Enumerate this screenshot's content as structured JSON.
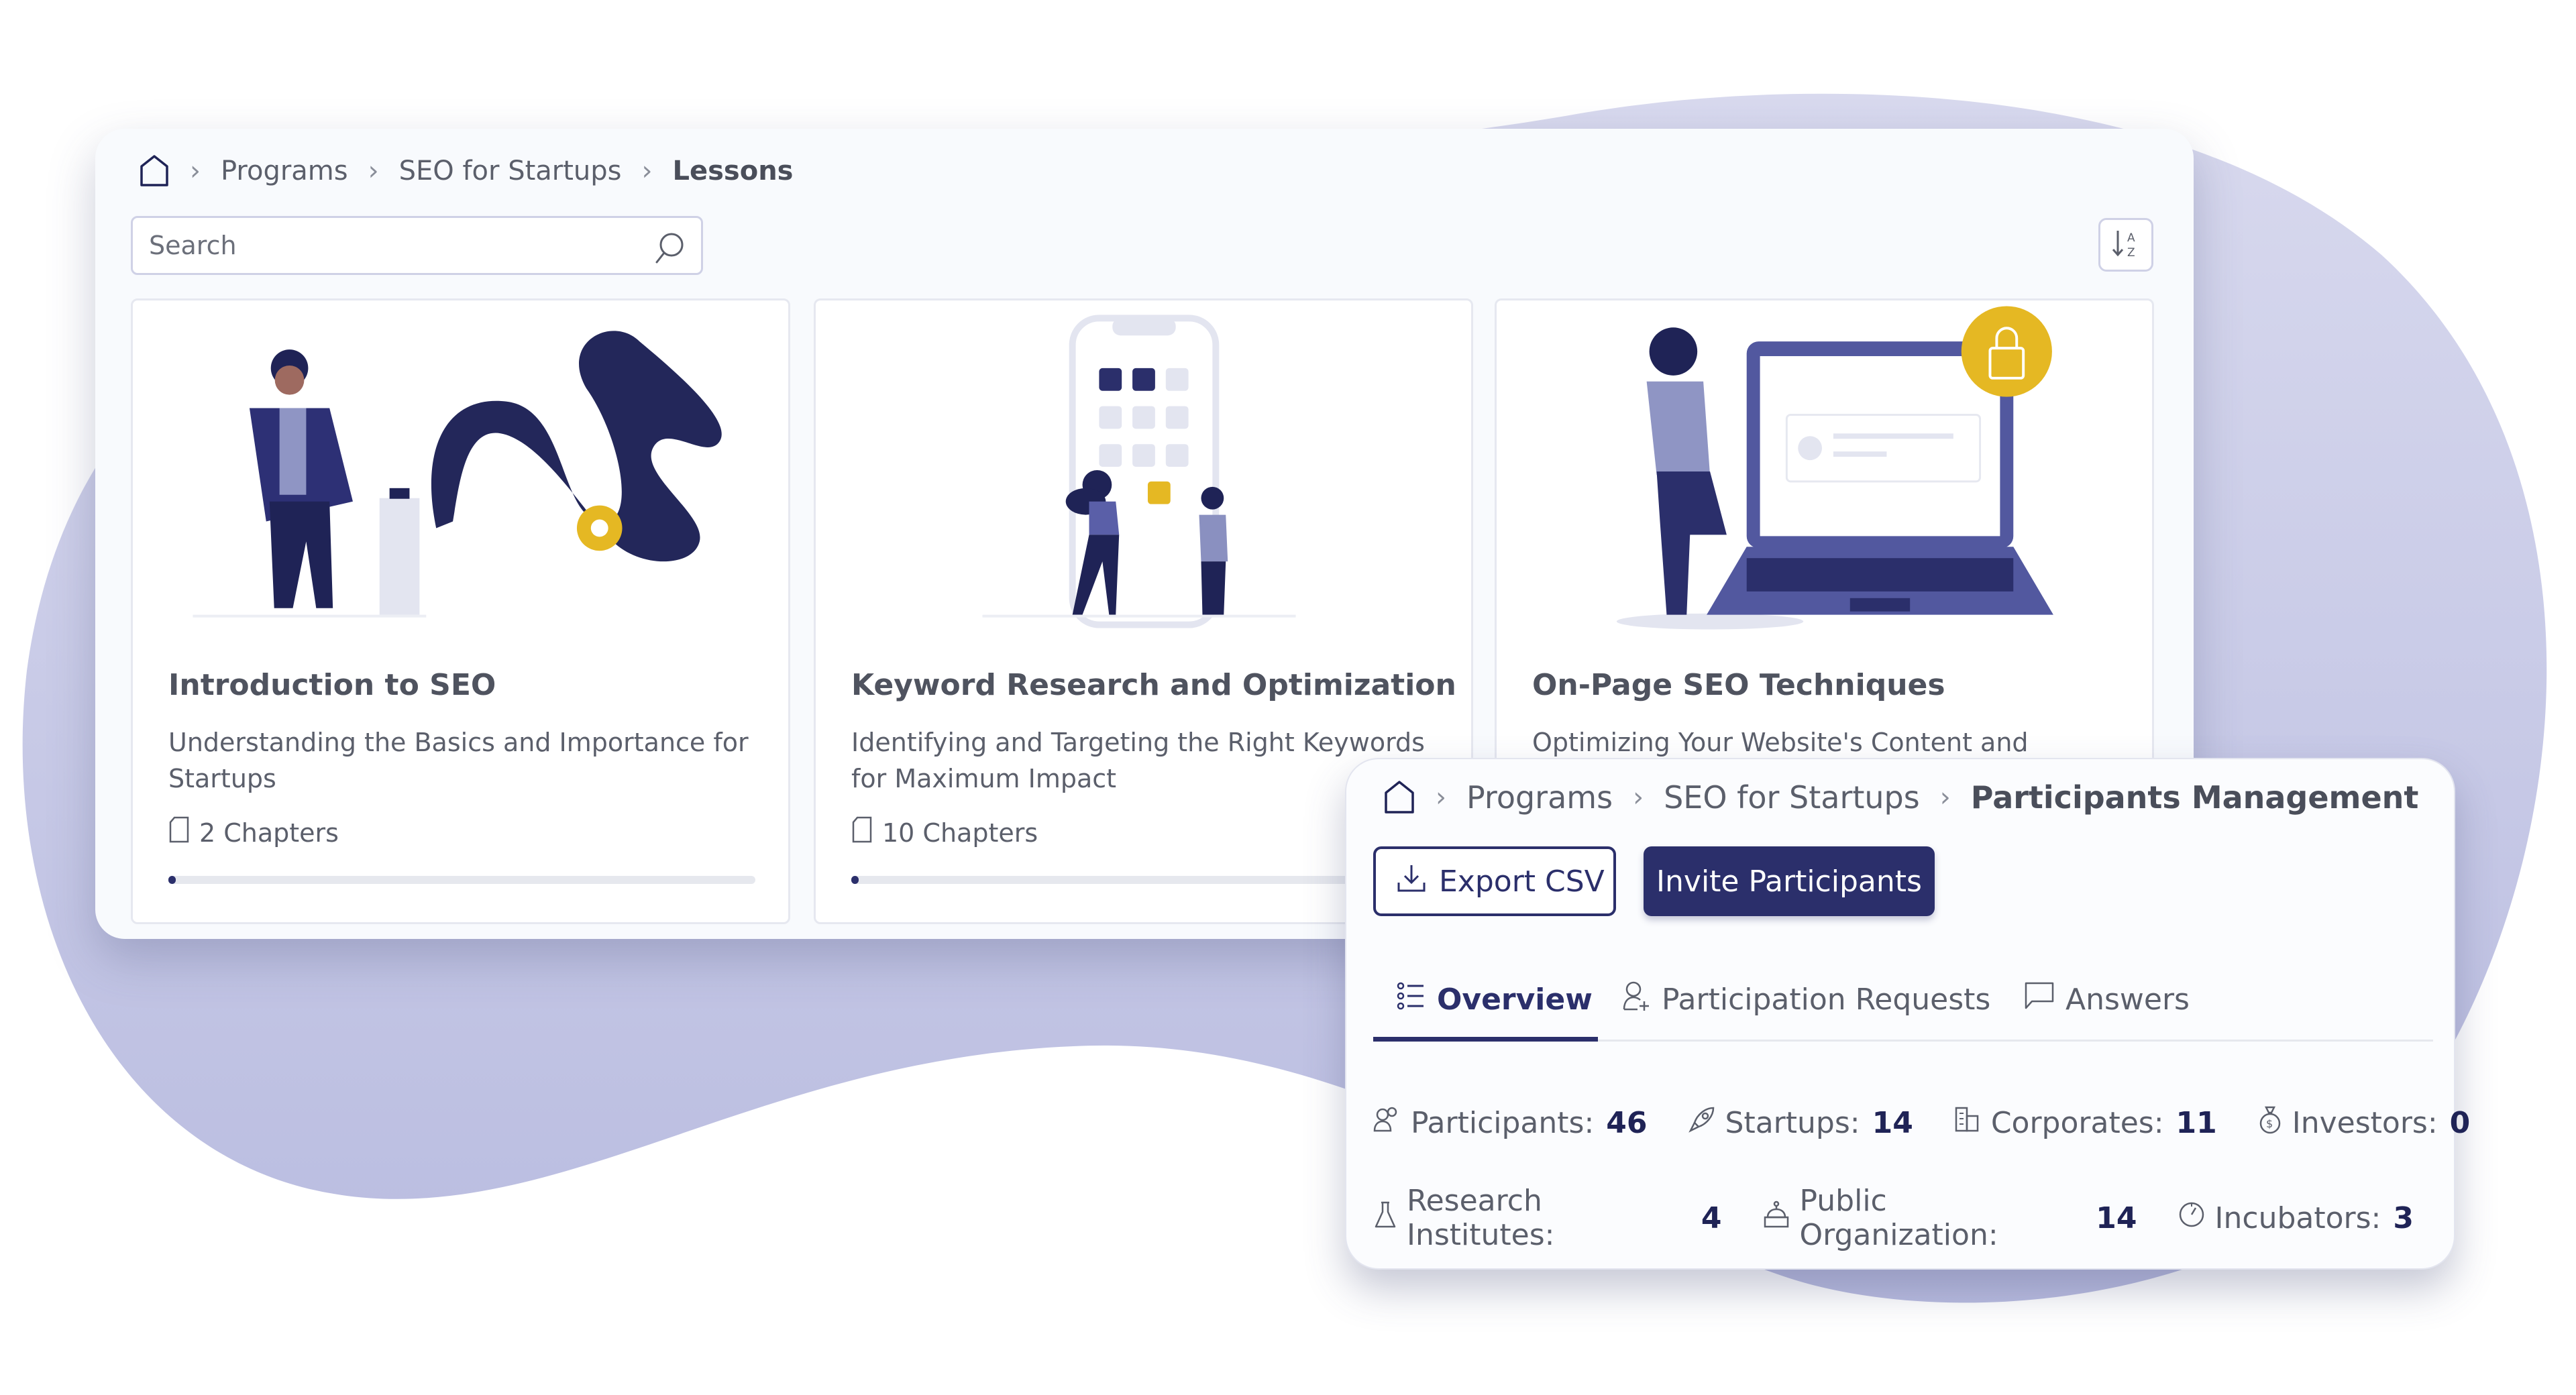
{
  "colors": {
    "primary": "#2b2f6b",
    "accent_yellow": "#e5b823",
    "blob": "#c9cbe6",
    "text": "#5b5f6b"
  },
  "lessons_view": {
    "breadcrumb": [
      {
        "label": "Programs"
      },
      {
        "label": "SEO for Startups"
      },
      {
        "label": "Lessons",
        "current": true
      }
    ],
    "search": {
      "placeholder": "Search",
      "value": ""
    },
    "sort_button": {
      "icon": "sort-alpha-down-icon"
    },
    "cards": [
      {
        "title": "Introduction to SEO",
        "description": "Understanding the Basics and Importance for Startups",
        "chapters": "2 Chapters",
        "progress": 0.01,
        "illustration": "person-pressing-launch-button"
      },
      {
        "title": "Keyword Research and Optimization",
        "description": "Identifying and Targeting the Right Keywords for Maximum Impact",
        "chapters": "10 Chapters",
        "progress": 0.01,
        "illustration": "people-arranging-app-tiles"
      },
      {
        "title": "On-Page SEO Techniques",
        "description": "Optimizing Your Website's Content and Structure",
        "chapters": "",
        "progress": 0,
        "illustration": "woman-with-locked-laptop",
        "locked": true
      }
    ]
  },
  "participants_view": {
    "breadcrumb": [
      {
        "label": "Programs"
      },
      {
        "label": "SEO for Startups"
      },
      {
        "label": "Participants Management",
        "current": true
      }
    ],
    "export_button": "Export CSV",
    "invite_button": "Invite Participants",
    "tabs": [
      {
        "label": "Overview",
        "active": true,
        "icon": "list-icon"
      },
      {
        "label": "Participation Requests",
        "active": false,
        "icon": "user-add-icon"
      },
      {
        "label": "Answers",
        "active": false,
        "icon": "comment-icon"
      }
    ],
    "stats_row1": [
      {
        "label": "Participants:",
        "value": "46",
        "icon": "users-icon"
      },
      {
        "label": "Startups:",
        "value": "14",
        "icon": "rocket-icon"
      },
      {
        "label": "Corporates:",
        "value": "11",
        "icon": "building-icon"
      },
      {
        "label": "Investors:",
        "value": "0",
        "icon": "money-bag-icon"
      }
    ],
    "stats_row2": [
      {
        "label": "Research Institutes:",
        "value": "4",
        "icon": "flask-icon"
      },
      {
        "label": "Public Organization:",
        "value": "14",
        "icon": "government-icon"
      },
      {
        "label": "Incubators:",
        "value": "3",
        "icon": "gauge-icon"
      }
    ]
  }
}
